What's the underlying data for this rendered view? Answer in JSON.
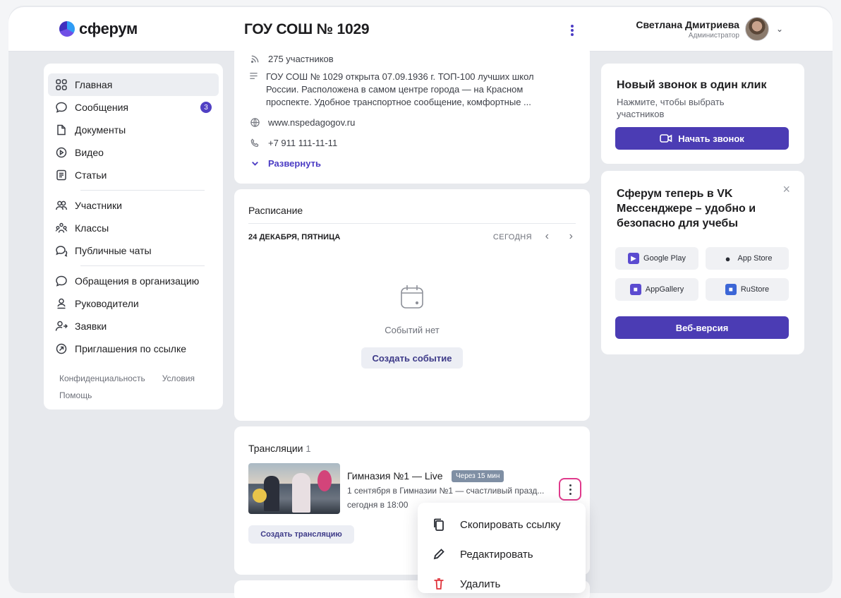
{
  "header": {
    "logo_text": "сферум",
    "org_title": "ГОУ СОШ № 1029",
    "user_name": "Светлана Дмитриева",
    "user_role": "Администратор"
  },
  "sidebar": {
    "items": [
      {
        "label": "Главная",
        "icon": "home-grid-icon"
      },
      {
        "label": "Сообщения",
        "icon": "message-icon",
        "badge": "3"
      },
      {
        "label": "Документы",
        "icon": "document-icon"
      },
      {
        "label": "Видео",
        "icon": "video-play-icon"
      },
      {
        "label": "Статьи",
        "icon": "article-icon"
      },
      {
        "label": "Участники",
        "icon": "people-icon"
      },
      {
        "label": "Классы",
        "icon": "classes-icon"
      },
      {
        "label": "Публичные чаты",
        "icon": "public-chat-icon"
      },
      {
        "label": "Обращения в организацию",
        "icon": "appeal-icon"
      },
      {
        "label": "Руководители",
        "icon": "person-icon"
      },
      {
        "label": "Заявки",
        "icon": "person-add-icon"
      },
      {
        "label": "Приглашения по ссылке",
        "icon": "link-arrow-icon"
      }
    ],
    "footer": {
      "privacy": "Конфиденциальность",
      "terms": "Условия",
      "help": "Помощь"
    }
  },
  "about": {
    "members": "275 участников",
    "description": "ГОУ СОШ № 1029 открыта 07.09.1936 г. ТОП-100 лучших школ России. Расположена в самом центре города — на Красном проспекте. Удобное транспортное сообщение, комфортные ...",
    "website": "www.nspedagogov.ru",
    "phone": "+7 911 111-11-11",
    "expand": "Развернуть"
  },
  "schedule": {
    "title": "Расписание",
    "date": "24 ДЕКАБРЯ, ПЯТНИЦА",
    "today": "СЕГОДНЯ",
    "empty": "Событий нет",
    "create": "Создать событие"
  },
  "broadcasts": {
    "title": "Трансляции",
    "count": "1",
    "item": {
      "name": "Гимназия №1 — Live",
      "pill": "Через 15 мин",
      "description": "1 сентября в Гимназии №1 — счастливый празд...",
      "time": "сегодня в 18:00"
    },
    "create": "Создать трансляцию"
  },
  "context_menu": {
    "items": [
      {
        "label": "Скопировать ссылку",
        "icon": "copy-icon"
      },
      {
        "label": "Редактировать",
        "icon": "pencil-icon"
      },
      {
        "label": "Удалить",
        "icon": "trash-icon"
      }
    ]
  },
  "call": {
    "title": "Новый звонок в один клик",
    "subtitle": "Нажмите, чтобы выбрать участников",
    "button": "Начать звонок"
  },
  "promo": {
    "title": "Сферум теперь в VK Мессенджере – удобно и безопасно для учебы",
    "stores": [
      {
        "label": "Google Play",
        "icon": "google-play-icon"
      },
      {
        "label": "App Store",
        "icon": "apple-icon"
      },
      {
        "label": "AppGallery",
        "icon": "appgallery-icon"
      },
      {
        "label": "RuStore",
        "icon": "rustore-icon"
      }
    ],
    "web_button": "Веб-версия"
  },
  "colors": {
    "accent": "#4b3cb4",
    "badge": "#5140c4",
    "highlight_border": "#e03a8c"
  }
}
